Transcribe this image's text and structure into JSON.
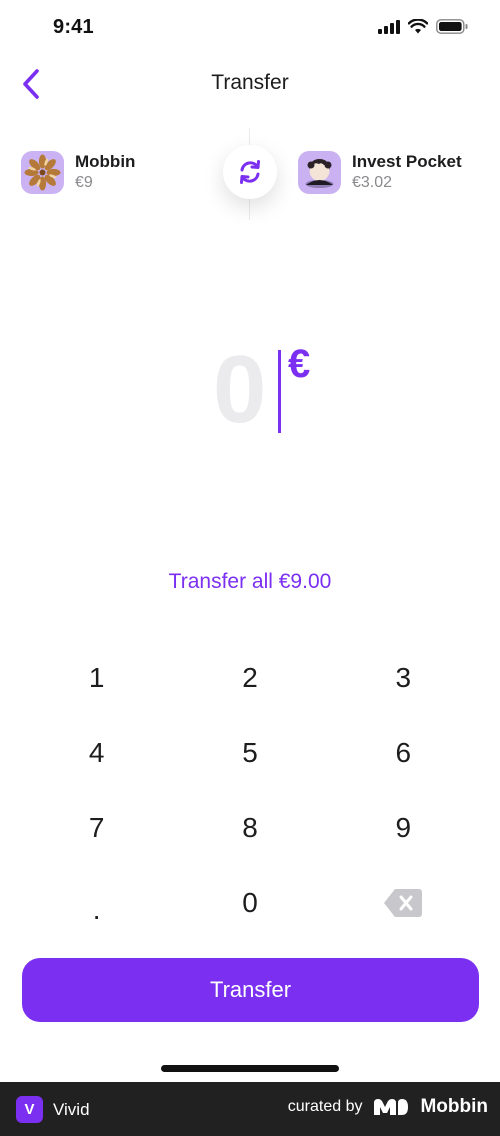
{
  "status_bar": {
    "time": "9:41"
  },
  "nav": {
    "title": "Transfer",
    "back_icon": "chevron-left-icon"
  },
  "accounts": {
    "from": {
      "name": "Mobbin",
      "balance": "€9"
    },
    "to": {
      "name": "Invest Pocket",
      "balance": "€3.02"
    },
    "swap_icon": "swap-refresh-icon"
  },
  "amount": {
    "value": "0",
    "currency": "€"
  },
  "transfer_all_label": "Transfer all €9.00",
  "keypad": {
    "keys": [
      "1",
      "2",
      "3",
      "4",
      "5",
      "6",
      "7",
      "8",
      "9",
      ".",
      "0"
    ],
    "backspace_icon": "backspace-icon"
  },
  "transfer_button_label": "Transfer",
  "footer": {
    "app_badge": "V",
    "app_name": "Vivid",
    "curated_label": "curated by",
    "brand": "Mobbin"
  },
  "colors": {
    "accent": "#7b2ff0",
    "footer_bg": "#212121",
    "amount_placeholder": "#ebebed"
  }
}
